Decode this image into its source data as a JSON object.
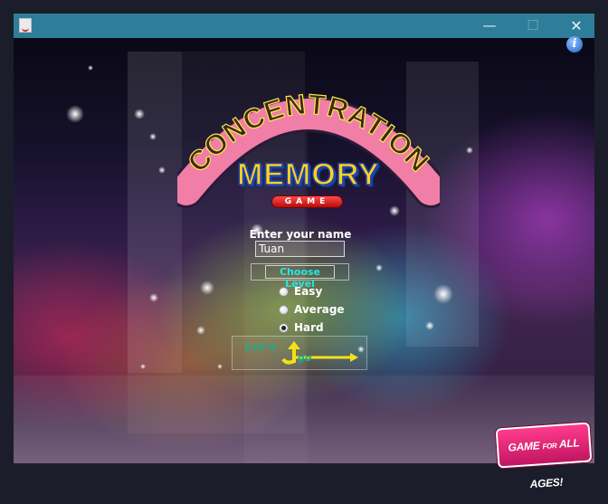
{
  "window": {
    "title": "",
    "minimize_glyph": "—",
    "maximize_glyph": "☐",
    "close_glyph": "✕",
    "icon": "java-cup-icon"
  },
  "header": {
    "info_glyph": "i",
    "logo_top": "CONCENTRATION",
    "logo_main": "MEMORY",
    "logo_sub": "GAME"
  },
  "form": {
    "name_label": "Enter your name",
    "name_value": "Tuan",
    "level_label": "Choose Level",
    "levels": [
      {
        "label": "Easy",
        "selected": false
      },
      {
        "label": "Average",
        "selected": false
      },
      {
        "label": "Hard",
        "selected": true
      }
    ],
    "start_button": {
      "text_top": "Let's",
      "text_bottom": "go",
      "icon": "arrow-up-right-icon"
    }
  },
  "badge": {
    "text_main": "GAME",
    "text_small": "FOR",
    "text_end": "ALL AGES!"
  },
  "colors": {
    "titlebar": "#2f7e99",
    "level_text": "#25e7e8",
    "go_text": "#0fb38e",
    "arrow": "#f2e21a",
    "badge": "#e8247a"
  }
}
